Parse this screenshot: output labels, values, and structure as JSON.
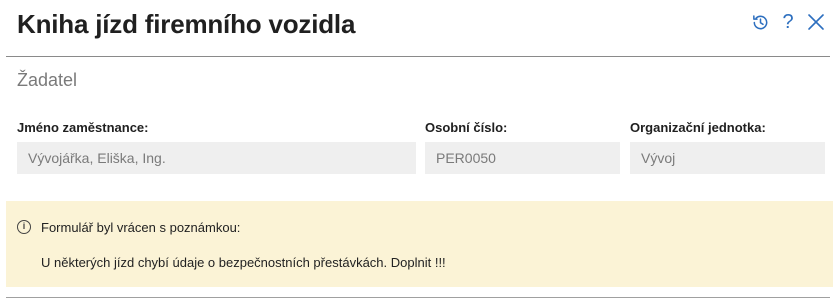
{
  "header": {
    "title": "Kniha jízd firemního vozidla",
    "icons": [
      "history-icon",
      "help-icon",
      "close-icon"
    ],
    "help_glyph": "?",
    "accent_color": "#2d6fbf"
  },
  "section": {
    "title": "Žadatel"
  },
  "fields": {
    "employee": {
      "label": "Jméno zaměstnance:",
      "value": "Vývojářka, Eliška, Ing."
    },
    "personal_number": {
      "label": "Osobní číslo:",
      "value": "PER0050"
    },
    "org_unit": {
      "label": "Organizační jednotka:",
      "value": "Vývoj"
    }
  },
  "notice": {
    "heading": "Formulář byl vrácen s poznámkou:",
    "message": "U některých jízd chybí údaje o bezpečnostních přestávkách. Doplnit !!!",
    "background_color": "#fbf3d6"
  }
}
